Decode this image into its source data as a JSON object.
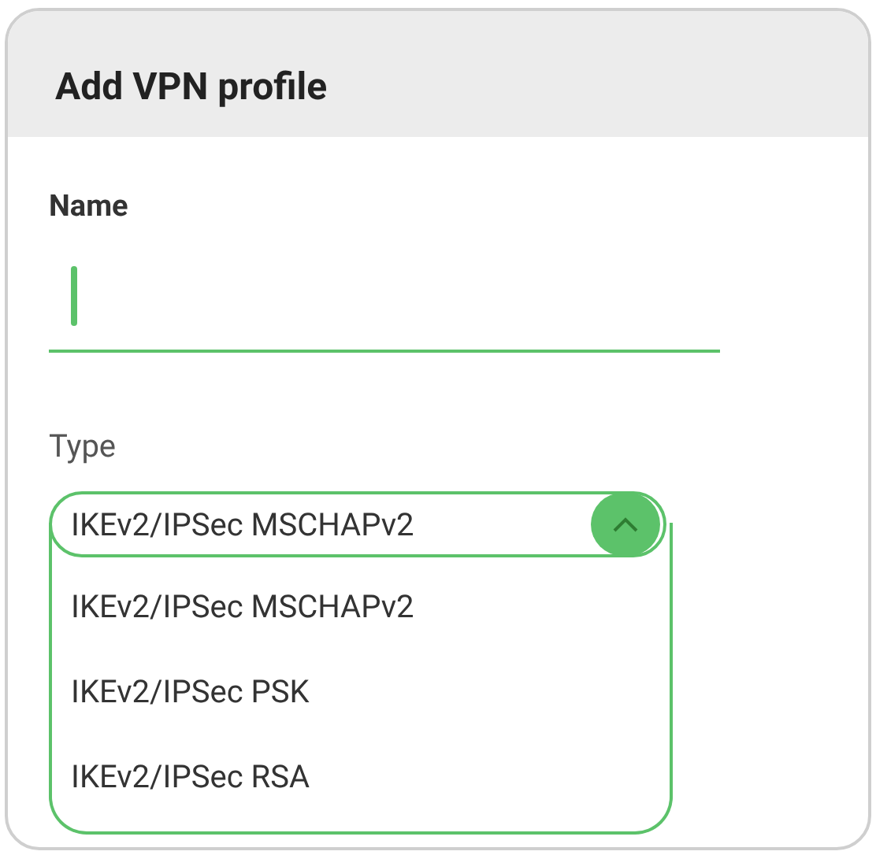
{
  "dialog": {
    "title": "Add VPN profile"
  },
  "name_field": {
    "label": "Name",
    "focused": true
  },
  "type_field": {
    "label": "Type",
    "value": "IKEv2/IPSec MSCHAPv2",
    "expanded": true,
    "options": [
      {
        "label": "IKEv2/IPSec MSCHAPv2"
      },
      {
        "label": "IKEv2/IPSec PSK"
      },
      {
        "label": "IKEv2/IPSec RSA"
      }
    ]
  }
}
